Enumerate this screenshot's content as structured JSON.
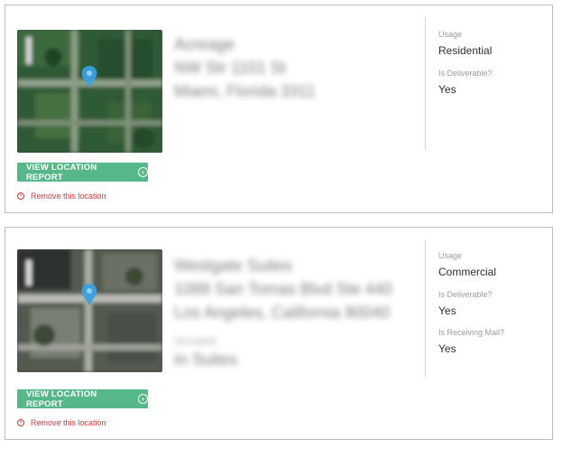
{
  "locations": [
    {
      "address": {
        "name": "Acreage",
        "street": "NW Str 1101 St",
        "city": "Miami, Florida 3311"
      },
      "view_report_label": "VIEW LOCATION REPORT",
      "remove_label": "Remove this location",
      "details": [
        {
          "label": "Usage",
          "value": "Residential"
        },
        {
          "label": "Is Deliverable?",
          "value": "Yes"
        }
      ]
    },
    {
      "address": {
        "name": "Westgate Suites",
        "street": "1088 San Tomas Blvd Ste 440",
        "city": "Los Angeles, California 90040",
        "sublabel": "Occupant",
        "suite": "In Suites"
      },
      "view_report_label": "VIEW LOCATION REPORT",
      "remove_label": "Remove this location",
      "details": [
        {
          "label": "Usage",
          "value": "Commercial"
        },
        {
          "label": "Is Deliverable?",
          "value": "Yes"
        },
        {
          "label": "Is Receiving Mail?",
          "value": "Yes"
        }
      ]
    }
  ],
  "colors": {
    "button": "#56b889",
    "remove": "#d23b3b",
    "pin": "#3aa0e0"
  }
}
